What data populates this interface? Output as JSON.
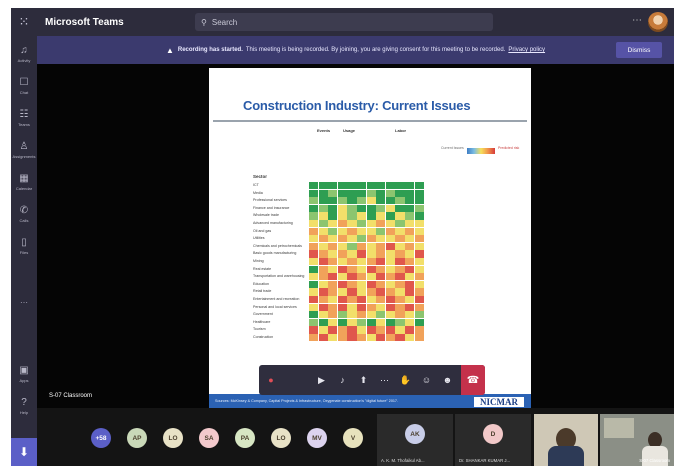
{
  "app": {
    "title": "Microsoft Teams",
    "search_placeholder": "Search"
  },
  "rail": [
    {
      "label": "Activity",
      "icon": "bell-icon",
      "glyph": "♫"
    },
    {
      "label": "Chat",
      "icon": "chat-icon",
      "glyph": "☐"
    },
    {
      "label": "Teams",
      "icon": "teams-icon",
      "glyph": "☷"
    },
    {
      "label": "Assignments",
      "icon": "assignments-icon",
      "glyph": "♙"
    },
    {
      "label": "Calendar",
      "icon": "calendar-icon",
      "glyph": "▦"
    },
    {
      "label": "Calls",
      "icon": "phone-icon",
      "glyph": "✆"
    },
    {
      "label": "Files",
      "icon": "file-icon",
      "glyph": "▯"
    },
    {
      "label": "Apps",
      "icon": "apps-icon",
      "glyph": "▣"
    },
    {
      "label": "Help",
      "icon": "help-icon",
      "glyph": "?"
    }
  ],
  "banner": {
    "bold": "Recording has started.",
    "text": "This meeting is being recorded. By joining, you are giving consent for this meeting to be recorded.",
    "link": "Privacy policy",
    "dismiss": "Dismiss"
  },
  "slide": {
    "title": "Construction Industry: Current Issues",
    "group_headers": [
      "Events",
      "Usage",
      "Labor"
    ],
    "legend_left": "Current Issues",
    "legend_right": "Predicted risk",
    "sector_header": "Sector",
    "sectors": [
      "ICT",
      "Media",
      "Professional services",
      "Finance and insurance",
      "Wholesale trade",
      "Advanced manufacturing",
      "Oil and gas",
      "Utilities",
      "Chemicals and petrochemicals",
      "Basic goods manufacturing",
      "Mining",
      "Real estate",
      "Transportation and warehousing",
      "Education",
      "Retail trade",
      "Entertainment and recreation",
      "Personal and local services",
      "Government",
      "Healthcare",
      "Tourism",
      "Construction"
    ],
    "grid": [
      "GGGGGGGGGGGG",
      "GGLGGGLGLGGG",
      "LGGLGLYGGLGG",
      "GLGYLGGLYGGL",
      "LYGYLYGYGYLG",
      "YLYOYLYOYLYY",
      "OYLYOYYLOYOY",
      "YOYOYLOYYOYO",
      "OYOYLOYORYOY",
      "ROYOYRYOYOYR",
      "YROYOYORYROY",
      "GOYROYROYORY",
      "YORYROYRORYO",
      "GYOROYROYORY",
      "YROYRYOROYRO",
      "ROYRORYOROYR",
      "YRORYROYRORO",
      "GYOLYOYLYOYL",
      "LGYGYLGYGLYG",
      "RYRORYRORYRO",
      "ORYOROYRORYO"
    ],
    "palette": {
      "G": "#2e9e52",
      "L": "#8cc56f",
      "Y": "#f2df6a",
      "O": "#f1a25a",
      "R": "#e0574c"
    },
    "footer_source": "Sources: McKinsey & Company, Capital Projects & Infrastructure, Oxygenate construction's \"digital future\" 2017.",
    "logo": "NICMAR"
  },
  "room_label": "S-07 Classroom",
  "controls": [
    {
      "name": "record-button",
      "glyph": "●"
    },
    {
      "name": "spacer",
      "glyph": ""
    },
    {
      "name": "camera-button",
      "glyph": "▶"
    },
    {
      "name": "mic-button",
      "glyph": "♪"
    },
    {
      "name": "share-button",
      "glyph": "⬆"
    },
    {
      "name": "more-options-button",
      "glyph": "⋯"
    },
    {
      "name": "raise-hand-button",
      "glyph": "✋"
    },
    {
      "name": "reactions-button",
      "glyph": "☺"
    },
    {
      "name": "participants-button",
      "glyph": "☻"
    }
  ],
  "hangup_glyph": "☎",
  "participants": {
    "overflow": "+58",
    "avatars": [
      {
        "initials": "AP",
        "color": "#c9d8b8"
      },
      {
        "initials": "LO",
        "color": "#e8e2c6"
      },
      {
        "initials": "SA",
        "color": "#f3c9cc"
      },
      {
        "initials": "PA",
        "color": "#d7e6c3"
      },
      {
        "initials": "LO",
        "color": "#e8e2c6"
      },
      {
        "initials": "MV",
        "color": "#dcd3ee"
      },
      {
        "initials": "V",
        "color": "#e7e2bd"
      }
    ],
    "tiles": [
      {
        "initials": "AK",
        "name": "A. K. M. Thofaikul Ab...",
        "color": "#c8cde8"
      },
      {
        "initials": "D",
        "name": "Dr. SHANKAR KUMAR J...",
        "color": "#f1c8c8"
      }
    ],
    "video_name": "S-07 Classroom"
  }
}
